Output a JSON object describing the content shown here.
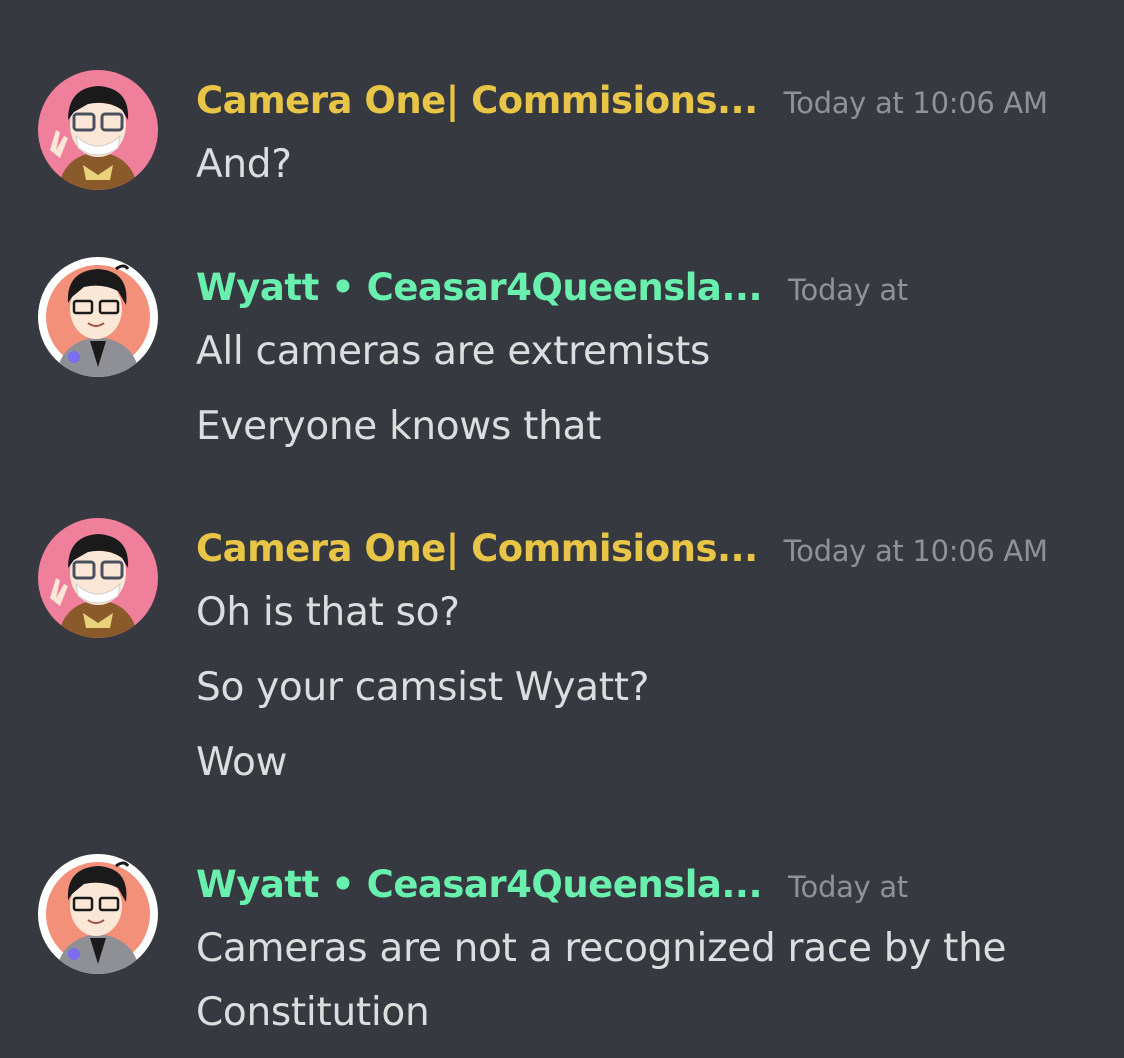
{
  "colors": {
    "background": "#36393f",
    "camera_name": "#e8c547",
    "wyatt_name": "#69f0ae",
    "message_text": "#dcddde",
    "timestamp": "#8e9297"
  },
  "messages": [
    {
      "author": "Camera One| Commisions...",
      "timestamp": "Today at 10:06 AM",
      "lines": [
        "And?"
      ]
    },
    {
      "author": "Wyatt • Ceasar4Queensla...",
      "timestamp": "Today at",
      "lines": [
        "All cameras are extremists",
        "Everyone knows that"
      ]
    },
    {
      "author": "Camera One| Commisions...",
      "timestamp": "Today at 10:06 AM",
      "lines": [
        "Oh is that so?",
        "So your camsist Wyatt?",
        "Wow"
      ]
    },
    {
      "author": "Wyatt • Ceasar4Queensla...",
      "timestamp": "Today at",
      "lines": [
        "Cameras are not a recognized race by the",
        "Constitution"
      ]
    }
  ]
}
